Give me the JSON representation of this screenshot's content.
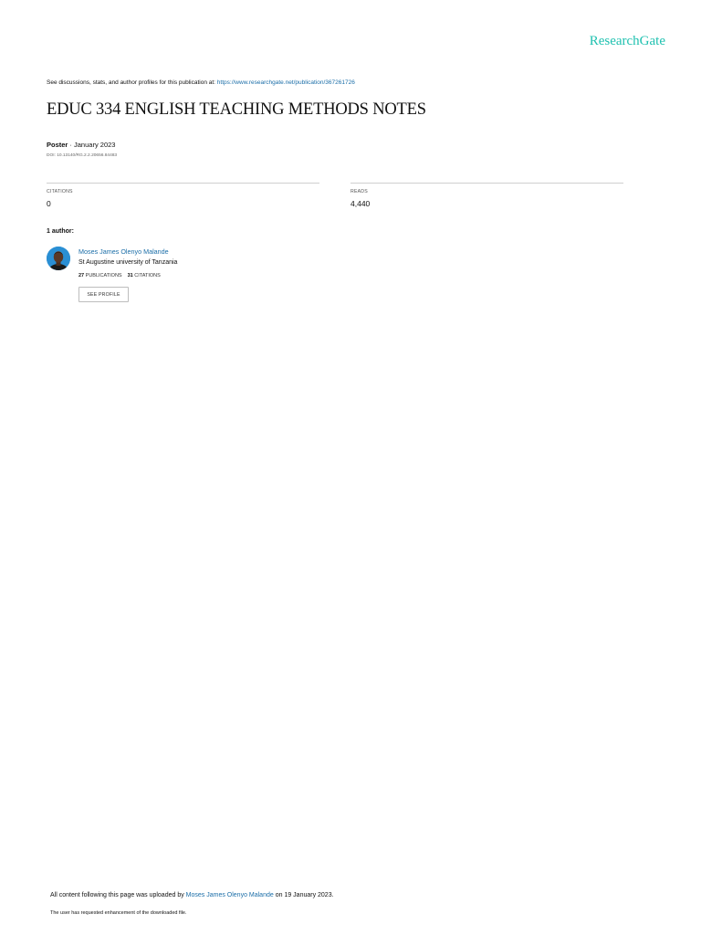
{
  "header": {
    "brand": "ResearchGate"
  },
  "discussion": {
    "prefix": "See discussions, stats, and author profiles for this publication at: ",
    "link": "https://www.researchgate.net/publication/367261726"
  },
  "publication": {
    "title": "EDUC 334 ENGLISH TEACHING METHODS NOTES",
    "type": "Poster",
    "date": "January 2023",
    "doi": "DOI: 10.13140/RG.2.2.20656.84483"
  },
  "stats": {
    "citations_label": "CITATIONS",
    "citations_value": "0",
    "reads_label": "READS",
    "reads_value": "4,440"
  },
  "authors": {
    "heading": "1 author:",
    "list": [
      {
        "name": "Moses James Olenyo Malande",
        "institution": "St Augustine university of Tanzania",
        "publications_count": "27",
        "publications_label": "PUBLICATIONS",
        "citations_count": "31",
        "citations_label": "CITATIONS",
        "profile_button": "SEE PROFILE"
      }
    ]
  },
  "footer": {
    "uploaded_prefix": "All content following this page was uploaded by ",
    "uploader": "Moses James Olenyo Malande",
    "uploaded_suffix": " on 19 January 2023.",
    "note": "The user has requested enhancement of the downloaded file."
  }
}
